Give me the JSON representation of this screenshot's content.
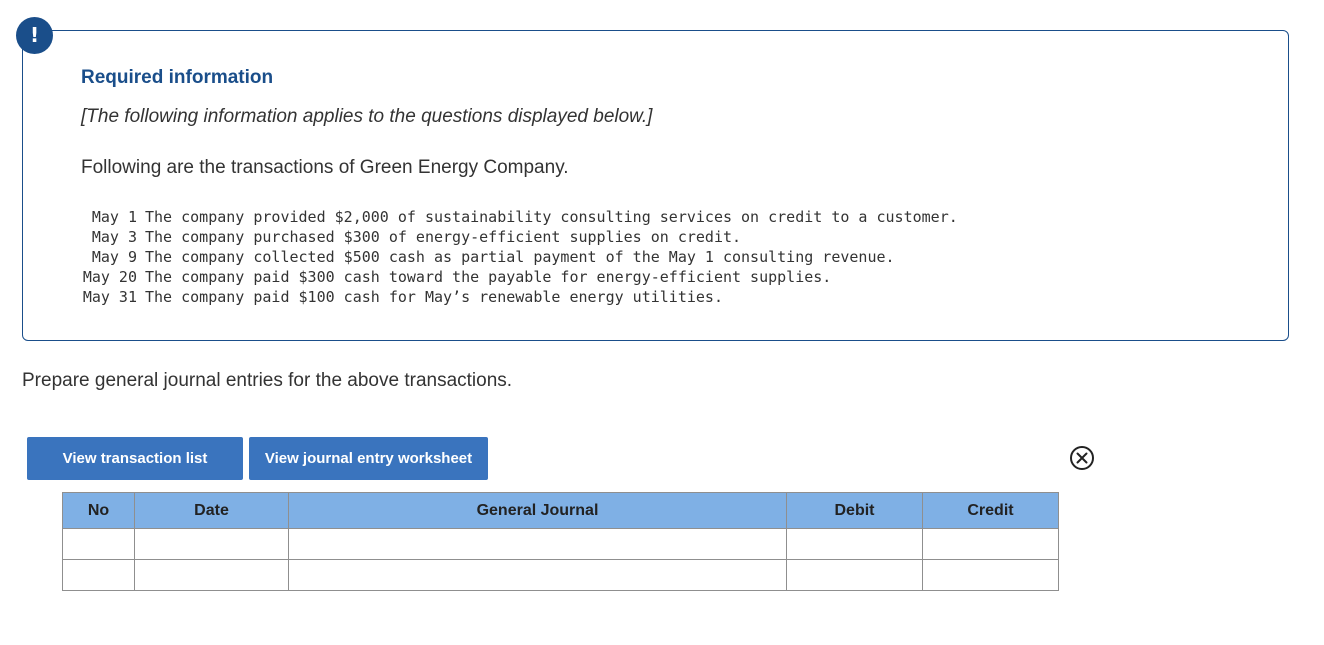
{
  "alert": {
    "icon_name": "exclamation-icon",
    "symbol": "!",
    "color": "#1a4e8a"
  },
  "info": {
    "title": "Required information",
    "note": "[The following information applies to the questions displayed below.]",
    "lead": "Following are the transactions of Green Energy Company.",
    "transactions": [
      {
        "date": "May 1",
        "text": "The company provided $2,000 of sustainability consulting services on credit to a customer."
      },
      {
        "date": "May 3",
        "text": "The company purchased $300 of energy-efficient supplies on credit."
      },
      {
        "date": "May 9",
        "text": "The company collected $500 cash as partial payment of the May 1 consulting revenue."
      },
      {
        "date": "May 20",
        "text": "The company paid $300 cash toward the payable for energy-efficient supplies."
      },
      {
        "date": "May 31",
        "text": "The company paid $100 cash for May’s renewable energy utilities."
      }
    ]
  },
  "prompt": "Prepare general journal entries for the above transactions.",
  "buttons": {
    "view_transaction_list": "View transaction list",
    "view_journal_worksheet": "View journal entry worksheet"
  },
  "close_icon": "close-circle-icon",
  "journal": {
    "columns": [
      "No",
      "Date",
      "General Journal",
      "Debit",
      "Credit"
    ],
    "rows": [
      [
        "",
        "",
        "",
        "",
        ""
      ],
      [
        "",
        "",
        "",
        "",
        ""
      ]
    ]
  },
  "colors": {
    "brand_blue": "#1a4e8a",
    "button_blue": "#3a74be",
    "table_header": "#7fb0e5"
  }
}
